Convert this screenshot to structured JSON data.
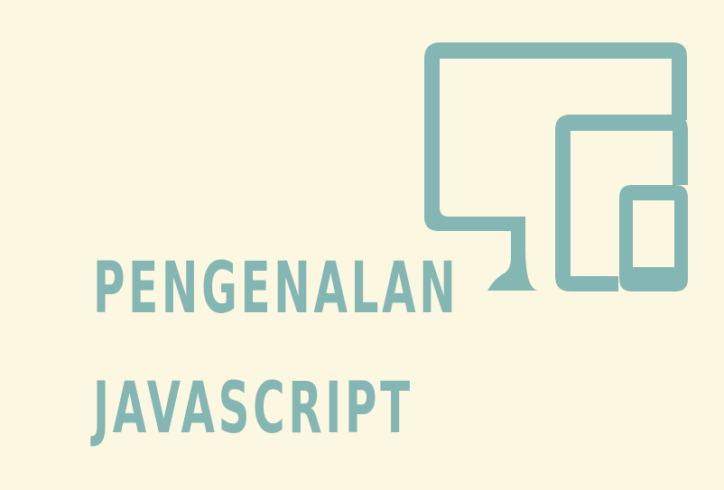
{
  "banner": {
    "title_line1": "PENGENALAN",
    "title_line2": "JAVASCRIPT"
  },
  "icon": "responsive-devices-icon",
  "colors": {
    "background": "#fcf7e1",
    "accent": "#84b6b4"
  }
}
